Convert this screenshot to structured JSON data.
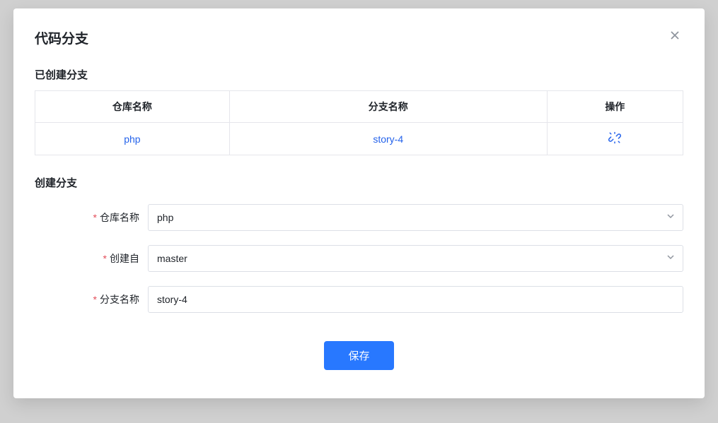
{
  "modal": {
    "title": "代码分支",
    "close_aria": "关闭"
  },
  "existing_section": {
    "title": "已创建分支",
    "columns": {
      "repo": "仓库名称",
      "branch": "分支名称",
      "action": "操作"
    },
    "rows": [
      {
        "repo": "php",
        "branch": "story-4"
      }
    ]
  },
  "create_section": {
    "title": "创建分支",
    "fields": {
      "repo": {
        "label": "仓库名称",
        "value": "php"
      },
      "from": {
        "label": "创建自",
        "value": "master"
      },
      "branch": {
        "label": "分支名称",
        "value": "story-4"
      }
    },
    "save_label": "保存"
  }
}
